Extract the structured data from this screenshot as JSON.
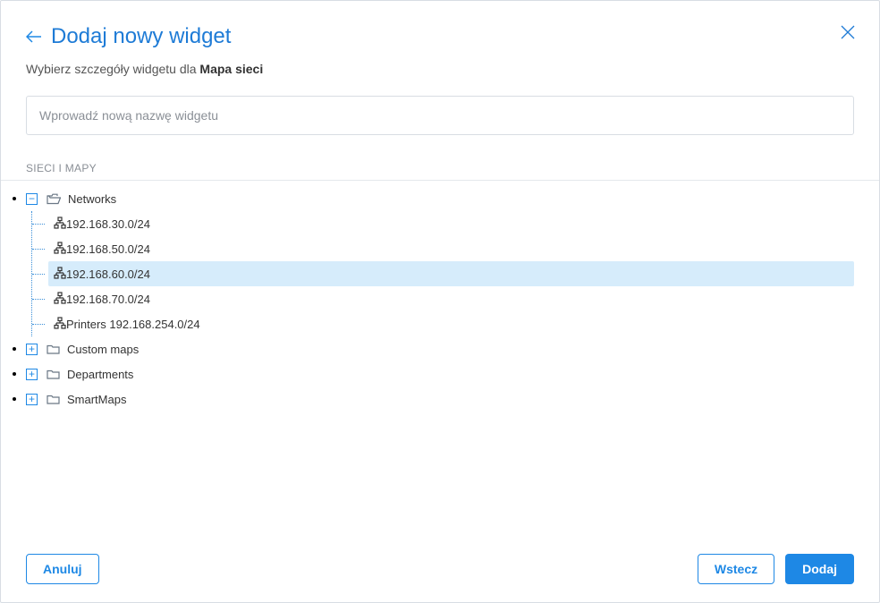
{
  "header": {
    "title": "Dodaj nowy widget",
    "subtitle_prefix": "Wybierz szczegóły widgetu dla ",
    "subtitle_bold": "Mapa sieci"
  },
  "input": {
    "placeholder": "Wprowadź nową nazwę widgetu",
    "value": ""
  },
  "section_label": "SIECI I MAPY",
  "tree": {
    "networks": {
      "label": "Networks",
      "expanded": true,
      "children": [
        {
          "label": "192.168.30.0/24",
          "selected": false
        },
        {
          "label": "192.168.50.0/24",
          "selected": false
        },
        {
          "label": "192.168.60.0/24",
          "selected": true
        },
        {
          "label": "192.168.70.0/24",
          "selected": false
        },
        {
          "label": "Printers 192.168.254.0/24",
          "selected": false
        }
      ]
    },
    "custom_maps": {
      "label": "Custom maps",
      "expanded": false
    },
    "departments": {
      "label": "Departments",
      "expanded": false
    },
    "smartmaps": {
      "label": "SmartMaps",
      "expanded": false
    }
  },
  "toggle": {
    "minus": "−",
    "plus": "+"
  },
  "footer": {
    "cancel": "Anuluj",
    "back": "Wstecz",
    "add": "Dodaj"
  }
}
